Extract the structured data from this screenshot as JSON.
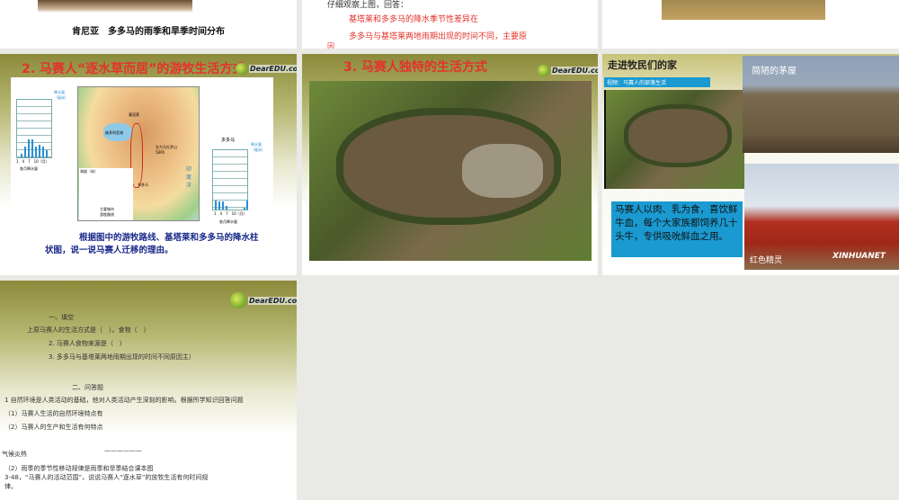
{
  "slides": [
    {
      "id": "slide-top-left",
      "caption": "肯尼亚　多多马的雨季和旱季时间分布"
    },
    {
      "id": "slide-top-mid",
      "lines": [
        "仔细观察上图，回答：",
        "基塔莱和多多马的降水季节性差异在",
        "多多马与基塔莱两地雨期出现的时间不同，主要原",
        "因"
      ]
    },
    {
      "id": "slide-2",
      "title": "2. 马赛人“逐水草而居”的游牧生活方式",
      "chart_left": {
        "city": "基塔莱",
        "unit": "降水量（毫米）",
        "ticks": [
          "700",
          "600",
          "500",
          "400",
          "300",
          "200",
          "100"
        ],
        "months": "1　4　7　10（月）",
        "legend": "各月降水量"
      },
      "map": {
        "labels": [
          "基塔莱",
          "维多利亚湖",
          "乞力马扎罗山 5895",
          "多多马",
          "印度洋"
        ],
        "legend_title": "海拔（米）",
        "elev": [
          "5000",
          "3000",
          "2000",
          "1000",
          "500",
          "200",
          "0"
        ],
        "legend_items": [
          "主要城市",
          "游牧路线"
        ]
      },
      "chart_right": {
        "city": "多多马",
        "unit": "降水量（毫米）",
        "ticks": [
          "700",
          "600",
          "500",
          "400",
          "300",
          "200",
          "100",
          "0"
        ],
        "months": "1　4　7　10（月）",
        "legend": "各月降水量"
      },
      "question": "根据图中的游牧路线、基塔莱和多多马的降水柱状图，说一说马赛人迁移的理由。",
      "logo": "DearEDU.com"
    },
    {
      "id": "slide-3",
      "title": "3. 马赛人独特的生活方式",
      "logo": "DearEDU.com"
    },
    {
      "id": "slide-4",
      "title": "走进牧民们的家",
      "video_label": "视频：马赛人的部落生活",
      "hut_caption": "简陋的茅屋",
      "info": "马赛人以肉、乳为食，喜饮鲜牛血，每个大家族都饲养几十头牛，专供吸吮鲜血之用。",
      "people_caption": "红色精灵",
      "watermark": "XINHUANET"
    },
    {
      "id": "slide-5",
      "logo": "DearEDU.com",
      "lines": [
        "一、填空",
        "上原马赛人的生活方式是（　）。食物（　）",
        "2. 马赛人食物来源是（　）",
        "3. 多多马与基塔莱两地雨期出现的时间不同原因主）",
        "二、问答题",
        "1 自然环境是人类活动的基础，他对人类活动产生深刻的影响。根据所学知识回答问题",
        "（1）马赛人生活的自然环境特点有",
        "（2）马赛人的生产和生活有何特点",
        "气候炎热",
        "——————",
        "（2）雨季的季节性移动规律是雨季和旱季结合课本图",
        "3-48，“马赛人的活动范围”，说说马赛人“逐水草”的放牧生活有何时间规",
        "律。"
      ]
    }
  ],
  "colors": {
    "title_red": "#e3332b",
    "info_blue": "#1a9ad0",
    "text_blue": "#1a2a8a"
  }
}
